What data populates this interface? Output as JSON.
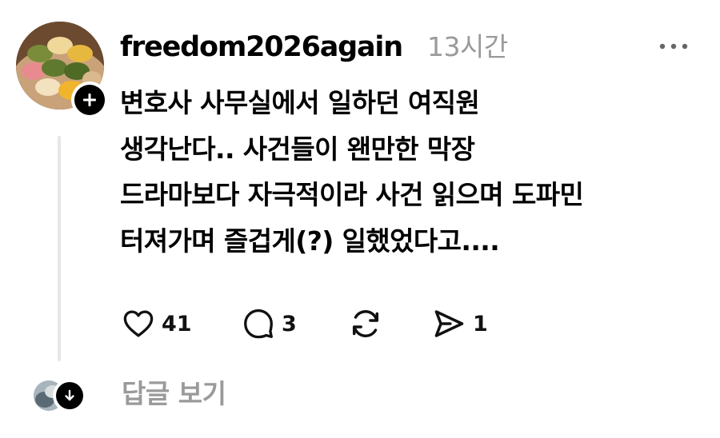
{
  "post": {
    "username": "freedom2026again",
    "time": "13시간",
    "lines": [
      "변호사 사무실에서 일하던 여직원",
      "생각난다.. 사건들이 왠만한 막장",
      "드라마보다 자극적이라 사건 읽으며 도파민",
      "터져가며 즐겁게(?) 일했었다고...."
    ],
    "actions": {
      "likes": "41",
      "comments": "3",
      "shares": "1"
    }
  },
  "replies": {
    "label": "답글 보기"
  },
  "icons": {
    "avatar": "food-photo-avatar",
    "follow": "plus-icon",
    "more": "more-horizontal-icon",
    "like": "heart-icon",
    "comment": "comment-bubble-icon",
    "repost": "repost-icon",
    "share": "send-icon",
    "expand": "arrow-down-icon"
  },
  "colors": {
    "text": "#000000",
    "muted": "#9a9a9a",
    "thread_line": "#e6e6e6"
  }
}
